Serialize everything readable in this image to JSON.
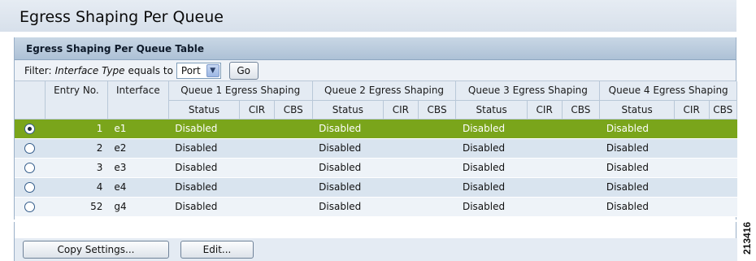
{
  "page": {
    "title": "Egress Shaping Per Queue",
    "figure_id": "213416"
  },
  "table_panel": {
    "title": "Egress Shaping Per Queue Table",
    "filter": {
      "label": "Filter:",
      "field": "Interface Type",
      "operator": "equals to",
      "selected": "Port",
      "go_label": "Go"
    },
    "columns": {
      "entry_no": "Entry No.",
      "interface": "Interface",
      "groups": [
        "Queue 1 Egress Shaping",
        "Queue 2 Egress Shaping",
        "Queue 3 Egress Shaping",
        "Queue 4 Egress Shaping"
      ],
      "sub": [
        "Status",
        "CIR",
        "CBS"
      ]
    },
    "rows": [
      {
        "entry": "1",
        "interface": "e1",
        "selected": true,
        "queues": [
          [
            "Disabled",
            "",
            ""
          ],
          [
            "Disabled",
            "",
            ""
          ],
          [
            "Disabled",
            "",
            ""
          ],
          [
            "Disabled",
            "",
            ""
          ]
        ]
      },
      {
        "entry": "2",
        "interface": "e2",
        "selected": false,
        "queues": [
          [
            "Disabled",
            "",
            ""
          ],
          [
            "Disabled",
            "",
            ""
          ],
          [
            "Disabled",
            "",
            ""
          ],
          [
            "Disabled",
            "",
            ""
          ]
        ]
      },
      {
        "entry": "3",
        "interface": "e3",
        "selected": false,
        "queues": [
          [
            "Disabled",
            "",
            ""
          ],
          [
            "Disabled",
            "",
            ""
          ],
          [
            "Disabled",
            "",
            ""
          ],
          [
            "Disabled",
            "",
            ""
          ]
        ]
      },
      {
        "entry": "4",
        "interface": "e4",
        "selected": false,
        "queues": [
          [
            "Disabled",
            "",
            ""
          ],
          [
            "Disabled",
            "",
            ""
          ],
          [
            "Disabled",
            "",
            ""
          ],
          [
            "Disabled",
            "",
            ""
          ]
        ]
      },
      {
        "entry": "52",
        "interface": "g4",
        "selected": false,
        "queues": [
          [
            "Disabled",
            "",
            ""
          ],
          [
            "Disabled",
            "",
            ""
          ],
          [
            "Disabled",
            "",
            ""
          ],
          [
            "Disabled",
            "",
            ""
          ]
        ]
      }
    ],
    "buttons": {
      "copy_settings": "Copy Settings...",
      "edit": "Edit..."
    }
  },
  "colors": {
    "selected_row": "#7aa51b",
    "header_bg": "#adc1d6",
    "row_alt": "#d9e4ef"
  },
  "icons": {
    "radio": "radio-button",
    "dropdown": "chevron-down-icon"
  }
}
